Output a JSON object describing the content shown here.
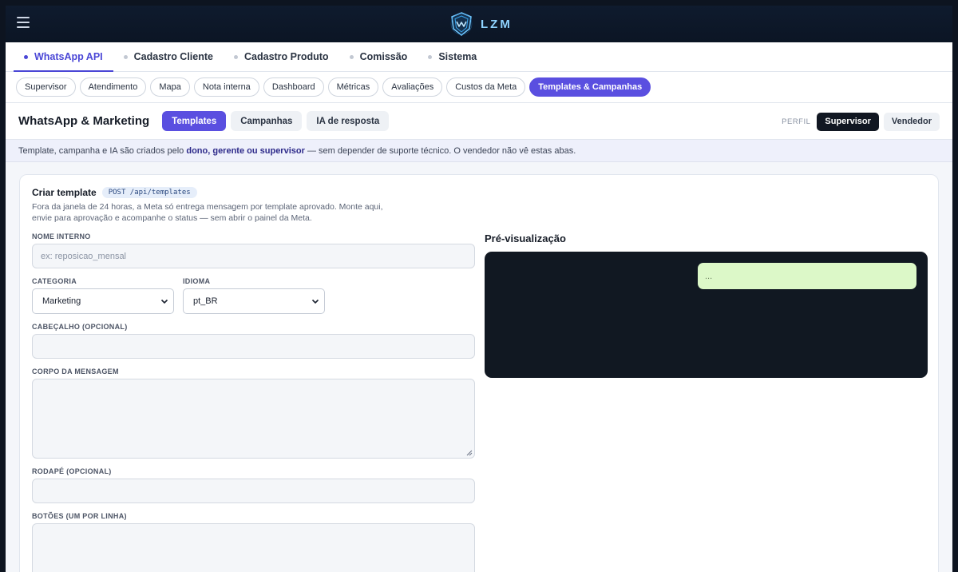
{
  "brand": {
    "name": "LZM"
  },
  "module_tabs": [
    {
      "label": "WhatsApp API"
    },
    {
      "label": "Cadastro Cliente"
    },
    {
      "label": "Cadastro Produto"
    },
    {
      "label": "Comissão"
    },
    {
      "label": "Sistema"
    }
  ],
  "sub_pills": [
    {
      "label": "Supervisor"
    },
    {
      "label": "Atendimento"
    },
    {
      "label": "Mapa"
    },
    {
      "label": "Nota interna"
    },
    {
      "label": "Dashboard"
    },
    {
      "label": "Métricas"
    },
    {
      "label": "Avaliações"
    },
    {
      "label": "Custos da Meta"
    },
    {
      "label": "Templates & Campanhas"
    }
  ],
  "section": {
    "title": "WhatsApp & Marketing",
    "tabs": [
      {
        "label": "Templates"
      },
      {
        "label": "Campanhas"
      },
      {
        "label": "IA de resposta"
      }
    ],
    "perfil_label": "PERFIL",
    "perfil_options": [
      {
        "label": "Supervisor"
      },
      {
        "label": "Vendedor"
      }
    ]
  },
  "info": {
    "prefix": "Template, campanha e IA são criados pelo ",
    "bold": "dono, gerente ou supervisor",
    "suffix": " — sem depender de suporte técnico. O vendedor não vê estas abas."
  },
  "form": {
    "title": "Criar template",
    "endpoint": "POST /api/templates",
    "description": "Fora da janela de 24 horas, a Meta só entrega mensagem por template aprovado. Monte aqui, envie para aprovação e acompanhe o status — sem abrir o painel da Meta.",
    "nome_label": "NOME INTERNO",
    "nome_placeholder": "ex: reposicao_mensal",
    "categoria_label": "CATEGORIA",
    "categoria_value": "Marketing",
    "idioma_label": "IDIOMA",
    "idioma_value": "pt_BR",
    "cabecalho_label": "CABEÇALHO (OPCIONAL)",
    "corpo_label": "CORPO DA MENSAGEM",
    "rodape_label": "RODAPÉ (OPCIONAL)",
    "botoes_label": "BOTÕES (UM POR LINHA)"
  },
  "preview": {
    "title": "Pré-visualização",
    "bubble_text": "..."
  }
}
